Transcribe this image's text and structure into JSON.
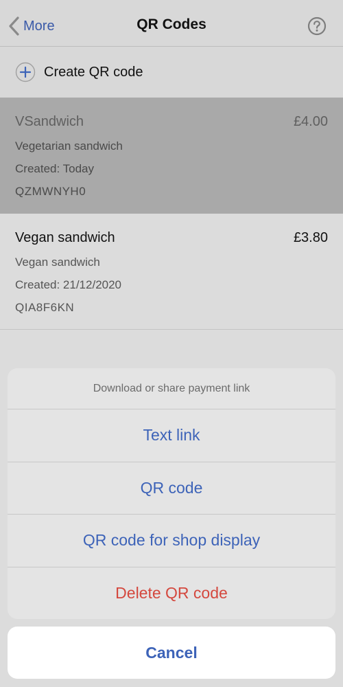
{
  "navbar": {
    "back_label": "More",
    "title": "QR Codes",
    "help_icon": "question-circle-icon"
  },
  "create": {
    "label": "Create QR code",
    "icon": "plus-circle-icon"
  },
  "items": [
    {
      "name": "VSandwich",
      "price": "£4.00",
      "description": "Vegetarian sandwich",
      "created": "Created: Today",
      "code": "QZMWNYH0",
      "selected": true
    },
    {
      "name": "Vegan sandwich",
      "price": "£3.80",
      "description": "Vegan sandwich",
      "created": "Created: 21/12/2020",
      "code": "QIA8F6KN",
      "selected": false
    }
  ],
  "action_sheet": {
    "title": "Download or share payment link",
    "buttons": [
      {
        "label": "Text link"
      },
      {
        "label": "QR code"
      },
      {
        "label": "QR code for shop display"
      },
      {
        "label": "Delete QR code"
      }
    ],
    "cancel_label": "Cancel"
  },
  "colors": {
    "accent": "#3d63b8",
    "destructive": "#d4483e",
    "selected_row": "#a9a9a9"
  }
}
